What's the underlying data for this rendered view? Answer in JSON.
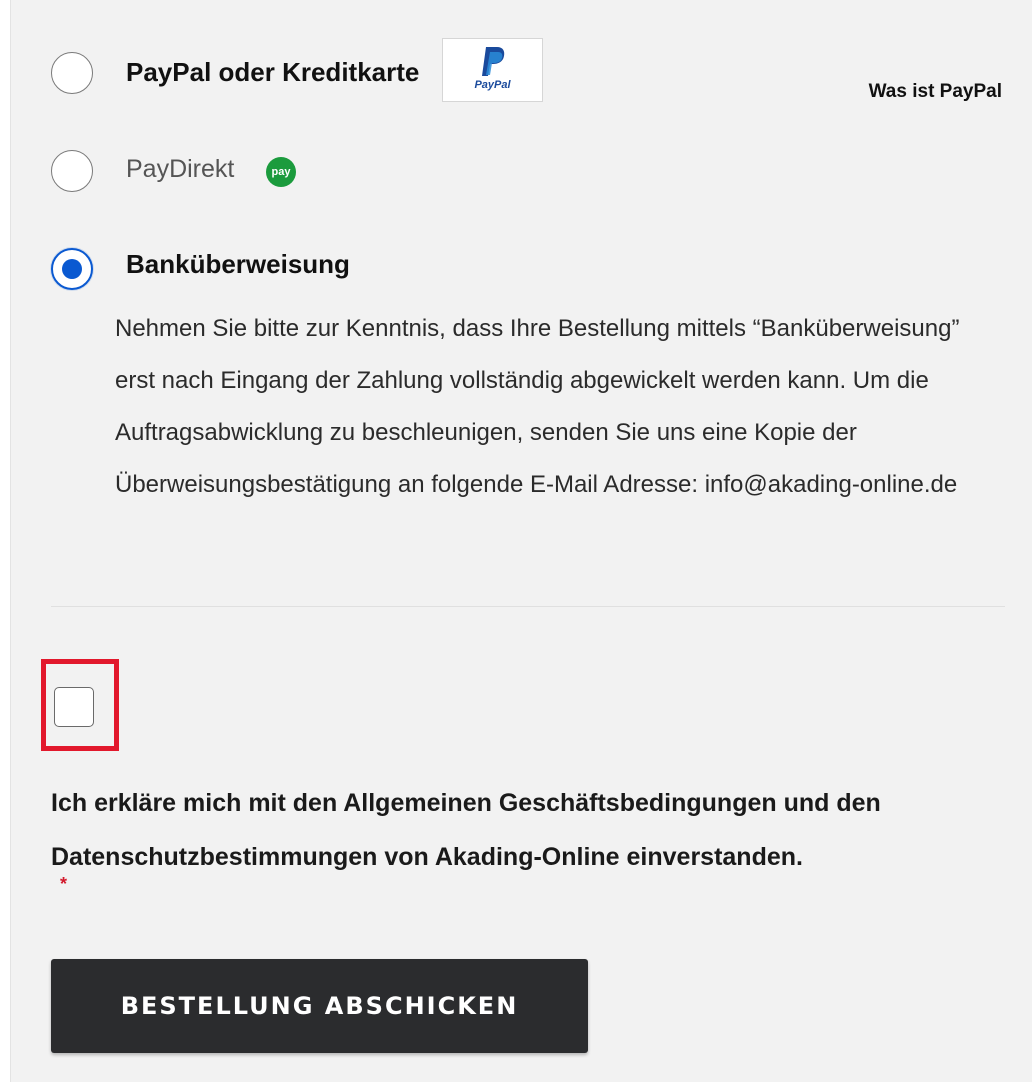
{
  "payment_options": {
    "paypal": {
      "label": "PayPal oder Kreditkarte",
      "logo_text": "PayPal",
      "info_link": "Was ist PayPal",
      "selected": false
    },
    "paydirekt": {
      "label": "PayDirekt",
      "icon_text": "pay",
      "selected": false
    },
    "bank": {
      "label": "Banküberweisung",
      "selected": true,
      "description": "Nehmen Sie bitte zur Kenntnis, dass Ihre Bestellung mittels “Banküberweisung” erst nach Eingang der Zahlung vollständig abgewickelt werden kann. Um die Auftragsabwicklung zu beschleunigen, senden Sie uns eine Kopie der Überweisungsbestätigung an folgende E-Mail Adresse: info@akading-online.de"
    }
  },
  "terms": {
    "checked": false,
    "text": "Ich erkläre mich mit den Allgemeinen Geschäftsbedingungen und den Datenschutzbestimmungen von Akading-Online einverstanden.",
    "required_marker": "*"
  },
  "submit": {
    "label": "BESTELLUNG ABSCHICKEN"
  },
  "colors": {
    "accent": "#0a59d1",
    "highlight": "#e2182c",
    "paydirekt_green": "#1b9b3d",
    "button_bg": "#2b2c2e"
  }
}
